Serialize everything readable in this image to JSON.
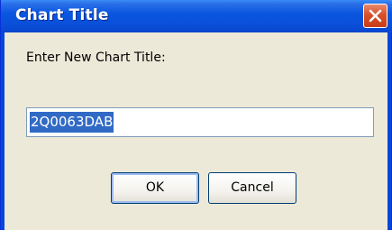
{
  "dialog": {
    "title": "Chart Title",
    "prompt": "Enter New Chart Title:",
    "input_value": "2Q0063DAB",
    "ok_label": "OK",
    "cancel_label": "Cancel"
  },
  "icons": {
    "close": "close-icon"
  },
  "colors": {
    "titlebar": "#0a50d9",
    "close_button": "#d8502a",
    "dialog_face": "#ece9d8",
    "selection": "#316ac5"
  }
}
